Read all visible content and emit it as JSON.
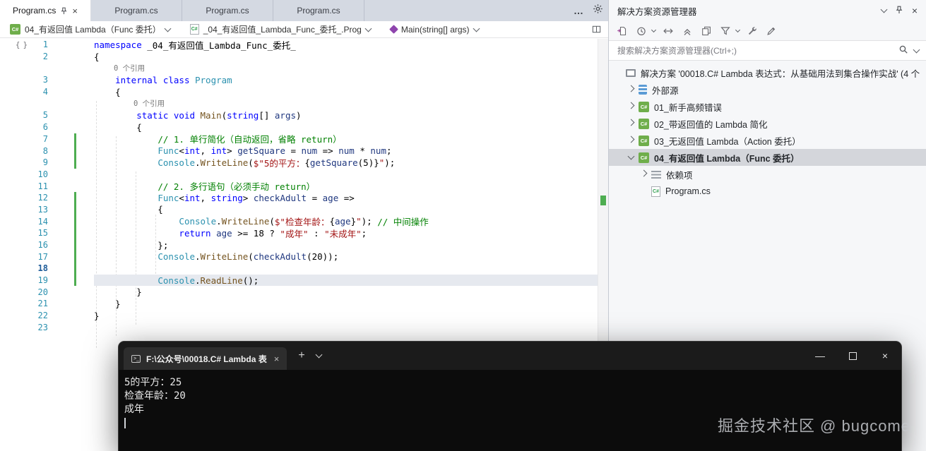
{
  "window": {
    "watermark": "掘金技术社区 @ bugcome"
  },
  "editor_tabs": {
    "overflow_label": "…",
    "items": [
      {
        "label": "Program.cs",
        "active": true
      },
      {
        "label": "Program.cs",
        "active": false
      },
      {
        "label": "Program.cs",
        "active": false
      },
      {
        "label": "Program.cs",
        "active": false
      }
    ]
  },
  "breadcrumb": {
    "project": "04_有返回值 Lambda（Func 委托）",
    "type": "_04_有返回值_Lambda_Func_委托_.Prog",
    "member": "Main(string[] args)"
  },
  "editor": {
    "lines": [
      {
        "n": 1,
        "segs": [
          [
            "kw",
            "namespace"
          ],
          [
            "p",
            " _04_有返回值_Lambda_Func_委托_"
          ]
        ]
      },
      {
        "n": 2,
        "segs": [
          [
            "p",
            "{"
          ]
        ]
      },
      {
        "lens": "0 个引用",
        "indent": 1
      },
      {
        "n": 3,
        "segs": [
          [
            "p",
            "    "
          ],
          [
            "kw",
            "internal class "
          ],
          [
            "ty",
            "Program"
          ]
        ]
      },
      {
        "n": 4,
        "segs": [
          [
            "p",
            "    {"
          ]
        ]
      },
      {
        "lens": "0 个引用",
        "indent": 2
      },
      {
        "n": 5,
        "segs": [
          [
            "p",
            "        "
          ],
          [
            "kw",
            "static void "
          ],
          [
            "m",
            "Main"
          ],
          [
            "p",
            "("
          ],
          [
            "kw",
            "string"
          ],
          [
            "p",
            "[] "
          ],
          [
            "l",
            "args"
          ],
          [
            "p",
            ")"
          ]
        ]
      },
      {
        "n": 6,
        "segs": [
          [
            "p",
            "        {"
          ]
        ]
      },
      {
        "n": 7,
        "bar": true,
        "segs": [
          [
            "p",
            "            "
          ],
          [
            "c",
            "// 1. 单行简化（自动返回，省略 return）"
          ]
        ]
      },
      {
        "n": 8,
        "bar": true,
        "segs": [
          [
            "p",
            "            "
          ],
          [
            "ty",
            "Func"
          ],
          [
            "p",
            "<"
          ],
          [
            "kw",
            "int"
          ],
          [
            "p",
            ", "
          ],
          [
            "kw",
            "int"
          ],
          [
            "p",
            "> "
          ],
          [
            "l",
            "getSquare"
          ],
          [
            "p",
            " = "
          ],
          [
            "l",
            "num"
          ],
          [
            "p",
            " => "
          ],
          [
            "l",
            "num"
          ],
          [
            "p",
            " * "
          ],
          [
            "l",
            "num"
          ],
          [
            "p",
            ";"
          ]
        ]
      },
      {
        "n": 9,
        "bar": true,
        "segs": [
          [
            "p",
            "            "
          ],
          [
            "ty",
            "Console"
          ],
          [
            "p",
            "."
          ],
          [
            "m",
            "WriteLine"
          ],
          [
            "p",
            "("
          ],
          [
            "s",
            "$\"5的平方："
          ],
          [
            "p",
            "{"
          ],
          [
            "l",
            "getSquare"
          ],
          [
            "p",
            "(5)}"
          ],
          [
            "s",
            "\""
          ],
          [
            "p",
            ");"
          ]
        ]
      },
      {
        "n": 10,
        "segs": []
      },
      {
        "n": 11,
        "segs": [
          [
            "p",
            "            "
          ],
          [
            "c",
            "// 2. 多行语句（必须手动 return）"
          ]
        ]
      },
      {
        "n": 12,
        "bar": true,
        "segs": [
          [
            "p",
            "            "
          ],
          [
            "ty",
            "Func"
          ],
          [
            "p",
            "<"
          ],
          [
            "kw",
            "int"
          ],
          [
            "p",
            ", "
          ],
          [
            "kw",
            "string"
          ],
          [
            "p",
            "> "
          ],
          [
            "l",
            "checkAdult"
          ],
          [
            "p",
            " = "
          ],
          [
            "l",
            "age"
          ],
          [
            "p",
            " =>"
          ]
        ]
      },
      {
        "n": 13,
        "bar": true,
        "segs": [
          [
            "p",
            "            {"
          ]
        ]
      },
      {
        "n": 14,
        "bar": true,
        "segs": [
          [
            "p",
            "                "
          ],
          [
            "ty",
            "Console"
          ],
          [
            "p",
            "."
          ],
          [
            "m",
            "WriteLine"
          ],
          [
            "p",
            "("
          ],
          [
            "s",
            "$\"检查年龄："
          ],
          [
            "p",
            "{"
          ],
          [
            "l",
            "age"
          ],
          [
            "p",
            "}"
          ],
          [
            "s",
            "\""
          ],
          [
            "p",
            "); "
          ],
          [
            "c",
            "// 中间操作"
          ]
        ]
      },
      {
        "n": 15,
        "bar": true,
        "segs": [
          [
            "p",
            "                "
          ],
          [
            "kw",
            "return "
          ],
          [
            "l",
            "age"
          ],
          [
            "p",
            " >= 18 ? "
          ],
          [
            "s",
            "\"成年\""
          ],
          [
            "p",
            " : "
          ],
          [
            "s",
            "\"未成年\""
          ],
          [
            "p",
            ";"
          ]
        ]
      },
      {
        "n": 16,
        "bar": true,
        "segs": [
          [
            "p",
            "            };"
          ]
        ]
      },
      {
        "n": 17,
        "bar": true,
        "segs": [
          [
            "p",
            "            "
          ],
          [
            "ty",
            "Console"
          ],
          [
            "p",
            "."
          ],
          [
            "m",
            "WriteLine"
          ],
          [
            "p",
            "("
          ],
          [
            "l",
            "checkAdult"
          ],
          [
            "p",
            "(20));"
          ]
        ]
      },
      {
        "n": 18,
        "bar": true,
        "cur": true,
        "segs": []
      },
      {
        "n": 19,
        "bar": true,
        "hl": true,
        "segs": [
          [
            "p",
            "            "
          ],
          [
            "ty",
            "Console"
          ],
          [
            "p",
            "."
          ],
          [
            "m",
            "ReadLine"
          ],
          [
            "p",
            "();"
          ]
        ]
      },
      {
        "n": 20,
        "segs": [
          [
            "p",
            "        }"
          ]
        ]
      },
      {
        "n": 21,
        "segs": [
          [
            "p",
            "    }"
          ]
        ]
      },
      {
        "n": 22,
        "segs": [
          [
            "p",
            "}"
          ]
        ]
      },
      {
        "n": 23,
        "segs": []
      }
    ]
  },
  "explorer": {
    "title": "解决方案资源管理器",
    "search_placeholder": "搜索解决方案资源管理器(Ctrl+;)",
    "toolbar_icons": [
      {
        "name": "sync-active-document-icon"
      },
      {
        "name": "history-icon",
        "dropdown": true
      },
      {
        "name": "compare-icon"
      },
      {
        "name": "collapse-all-icon"
      },
      {
        "name": "copy-icon"
      },
      {
        "name": "filter-icon",
        "dropdown": true
      },
      {
        "name": "wrench-icon"
      },
      {
        "name": "edit-icon"
      }
    ],
    "tree": [
      {
        "label": "解决方案 '00018.C# Lambda 表达式：从基础用法到集合操作实战' (4 个",
        "icon": "solution",
        "indent": 0,
        "chevron": null,
        "selected": false
      },
      {
        "label": "外部源",
        "icon": "external",
        "indent": 1,
        "chevron": "right",
        "selected": false
      },
      {
        "label": "01_新手高频错误",
        "icon": "project",
        "indent": 1,
        "chevron": "right",
        "selected": false
      },
      {
        "label": "02_带返回值的 Lambda 简化",
        "icon": "project",
        "indent": 1,
        "chevron": "right",
        "selected": false
      },
      {
        "label": "03_无返回值 Lambda（Action 委托）",
        "icon": "project",
        "indent": 1,
        "chevron": "right",
        "selected": false
      },
      {
        "label": "04_有返回值 Lambda（Func 委托）",
        "icon": "project",
        "indent": 1,
        "chevron": "down",
        "selected": true
      },
      {
        "label": "依赖项",
        "icon": "dependencies",
        "indent": 2,
        "chevron": "right",
        "selected": false
      },
      {
        "label": "Program.cs",
        "icon": "csfile",
        "indent": 2,
        "chevron": null,
        "selected": false
      }
    ]
  },
  "console": {
    "tab_title": "F:\\公众号\\00018.C# Lambda 表",
    "new_tab_label": "+",
    "lines": [
      "5的平方：25",
      "检查年龄：20",
      "成年"
    ]
  }
}
